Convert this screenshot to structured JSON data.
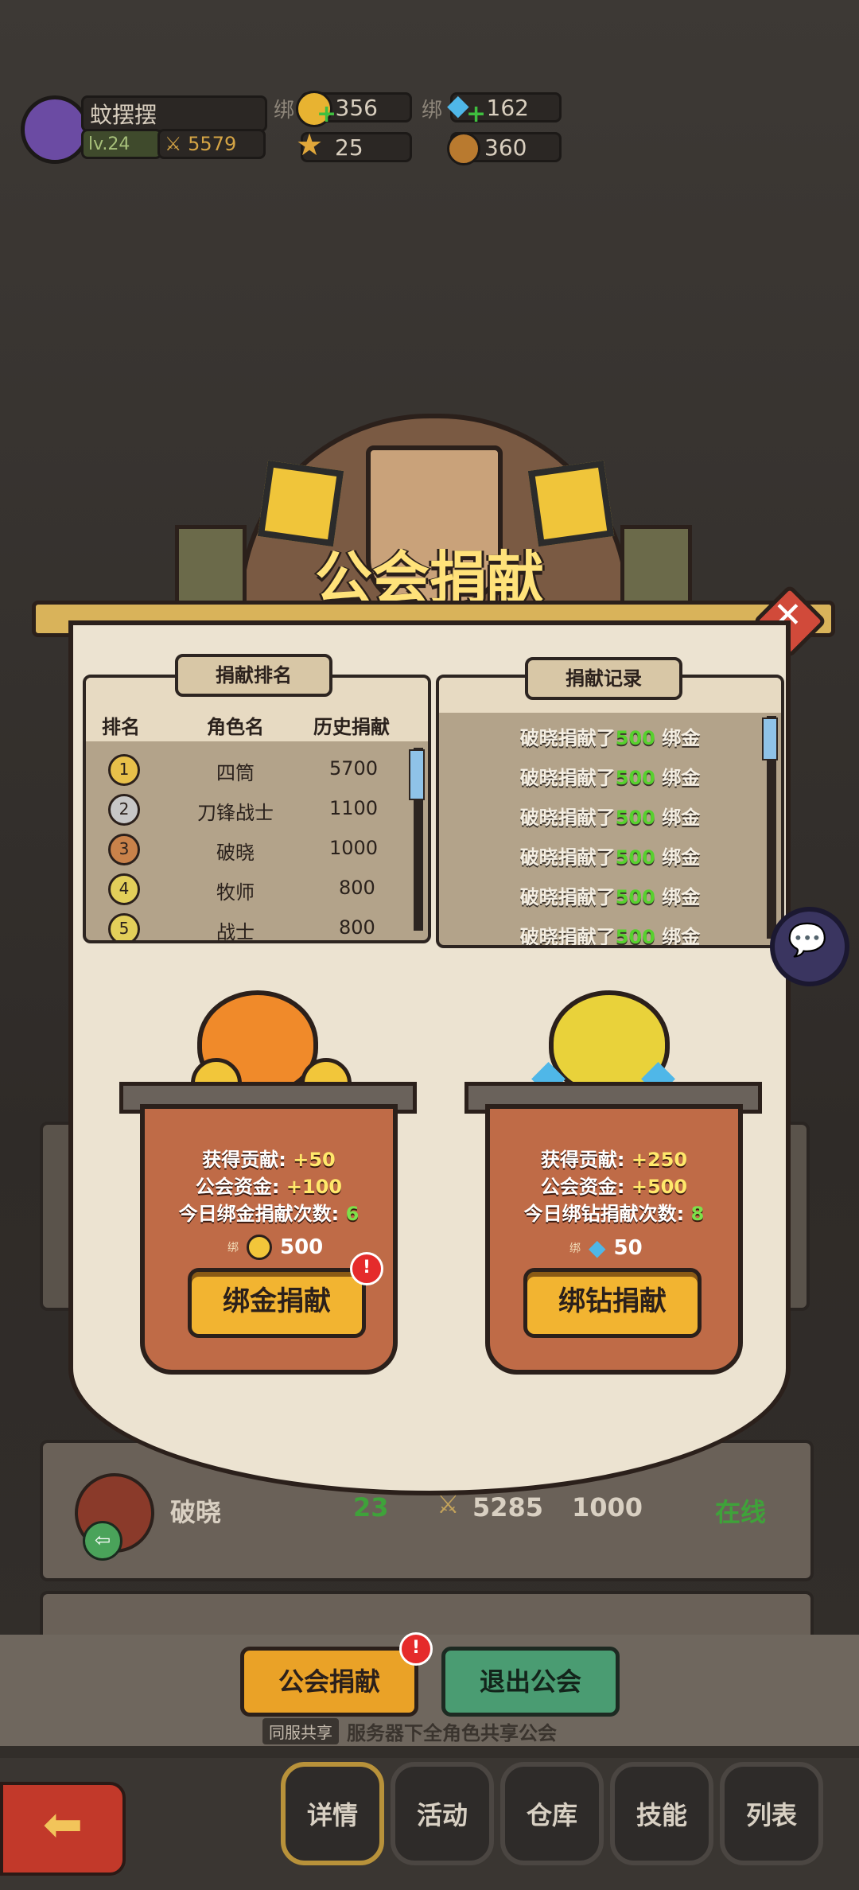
{
  "player": {
    "name": "蚊摆摆",
    "level": "lv.24",
    "power": "5579"
  },
  "currencies": {
    "bind_label_1": "绑",
    "bind_gold": "356",
    "bind_label_2": "绑",
    "bind_diamond": "162",
    "stars": "25",
    "coins": "360"
  },
  "panel": {
    "title": "公会捐献",
    "ranking": {
      "header": "捐献排名",
      "columns": [
        "排名",
        "角色名",
        "历史捐献"
      ],
      "rows": [
        {
          "rank": "1",
          "name": "四筒",
          "amount": "5700"
        },
        {
          "rank": "2",
          "name": "刀锋战士",
          "amount": "1100"
        },
        {
          "rank": "3",
          "name": "破晓",
          "amount": "1000"
        },
        {
          "rank": "4",
          "name": "牧师",
          "amount": "800"
        },
        {
          "rank": "5",
          "name": "战士",
          "amount": "800"
        }
      ]
    },
    "records": {
      "header": "捐献记录",
      "rows": [
        {
          "who": "破晓捐献了",
          "amt": "500",
          "unit": "绑金"
        },
        {
          "who": "破晓捐献了",
          "amt": "500",
          "unit": "绑金"
        },
        {
          "who": "破晓捐献了",
          "amt": "500",
          "unit": "绑金"
        },
        {
          "who": "破晓捐献了",
          "amt": "500",
          "unit": "绑金"
        },
        {
          "who": "破晓捐献了",
          "amt": "500",
          "unit": "绑金"
        },
        {
          "who": "破晓捐献了",
          "amt": "500",
          "unit": "绑金"
        }
      ]
    },
    "gold_option": {
      "gain_label": "获得贡献:",
      "gain_value": "+50",
      "fund_label": "公会资金:",
      "fund_value": "+100",
      "count_label": "今日绑金捐献次数:",
      "count_value": "6",
      "cost_tag": "绑",
      "cost": "500",
      "button": "绑金捐献",
      "badge": "!"
    },
    "diamond_option": {
      "gain_label": "获得贡献:",
      "gain_value": "+250",
      "fund_label": "公会资金:",
      "fund_value": "+500",
      "count_label": "今日绑钻捐献次数:",
      "count_value": "8",
      "cost_tag": "绑",
      "cost": "50",
      "button": "绑钻捐献"
    }
  },
  "member_row": {
    "name": "破晓",
    "level": "23",
    "power": "5285",
    "contrib": "1000",
    "status": "在线"
  },
  "bottom": {
    "donate_button": "公会捐献",
    "donate_badge": "!",
    "leave_button": "退出公会",
    "share_tag": "同服共享",
    "share_text": "服务器下全角色共享公会"
  },
  "nav": [
    "详情",
    "活动",
    "仓库",
    "技能",
    "列表"
  ],
  "colors": {
    "accent_yellow": "#f2b431",
    "online_green": "#3fa23a",
    "amount_green": "#57d12e"
  }
}
